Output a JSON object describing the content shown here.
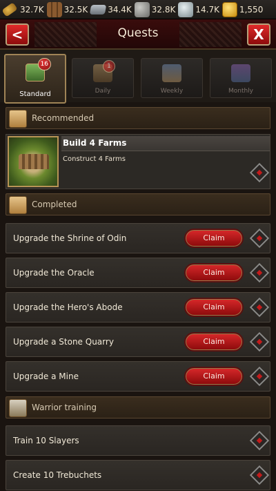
{
  "resources": [
    {
      "name": "food",
      "icon": "wheat-icon",
      "value": "32.7K"
    },
    {
      "name": "wood",
      "icon": "wood-icon",
      "value": "32.5K"
    },
    {
      "name": "iron",
      "icon": "iron-icon",
      "value": "34.4K"
    },
    {
      "name": "stone",
      "icon": "stone-icon",
      "value": "32.8K"
    },
    {
      "name": "silver",
      "icon": "silver-icon",
      "value": "14.7K"
    },
    {
      "name": "gold",
      "icon": "gold-icon",
      "value": "1,550"
    }
  ],
  "header": {
    "title": "Quests",
    "back_icon": "<",
    "close_icon": "X"
  },
  "tabs": [
    {
      "label": "Standard",
      "badge": "16",
      "active": true
    },
    {
      "label": "Daily",
      "badge": "1",
      "active": false
    },
    {
      "label": "Weekly",
      "badge": "",
      "active": false
    },
    {
      "label": "Monthly",
      "badge": "",
      "active": false
    }
  ],
  "sections": {
    "recommended": "Recommended",
    "completed": "Completed",
    "warrior": "Warrior training"
  },
  "featured": {
    "title": "Build 4 Farms",
    "subtitle": "Construct 4 Farms"
  },
  "completed": [
    {
      "label": "Upgrade the Shrine of Odin",
      "action": "Claim"
    },
    {
      "label": "Upgrade the Oracle",
      "action": "Claim"
    },
    {
      "label": "Upgrade the Hero's Abode",
      "action": "Claim"
    },
    {
      "label": "Upgrade a Stone Quarry",
      "action": "Claim"
    },
    {
      "label": "Upgrade a Mine",
      "action": "Claim"
    }
  ],
  "warrior": [
    {
      "label": "Train 10 Slayers"
    },
    {
      "label": "Create 10 Trebuchets"
    }
  ],
  "colors": {
    "accent_red": "#c21b1b",
    "gold_border": "#a08456"
  }
}
